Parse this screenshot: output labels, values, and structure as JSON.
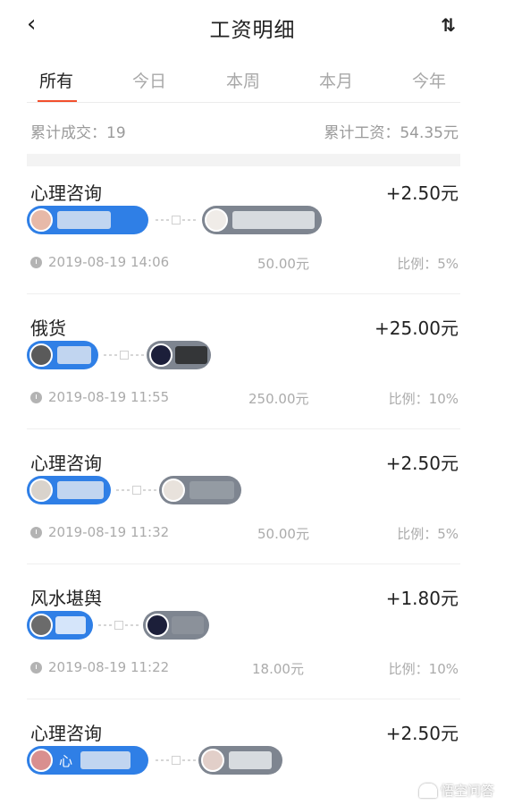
{
  "header": {
    "back_icon": "‹",
    "title": "工资明细",
    "sort_icon": "⇅"
  },
  "tabs": [
    {
      "label": "所有",
      "active": true
    },
    {
      "label": "今日",
      "active": false
    },
    {
      "label": "本周",
      "active": false
    },
    {
      "label": "本月",
      "active": false
    },
    {
      "label": "今年",
      "active": false
    }
  ],
  "accent_color": "#f2502d",
  "summary": {
    "total_deals": "累计成交：19",
    "total_wage": "累计工资：54.35元"
  },
  "records": [
    {
      "title": "心理咨询",
      "amount": "+2.50元",
      "from_text": "",
      "time": "2019-08-19 14:06",
      "price": "50.00元",
      "ratio": "比例：5%"
    },
    {
      "title": "俄货",
      "amount": "+25.00元",
      "from_text": "",
      "time": "2019-08-19 11:55",
      "price": "250.00元",
      "ratio": "比例：10%"
    },
    {
      "title": "心理咨询",
      "amount": "+2.50元",
      "from_text": "",
      "time": "2019-08-19 11:32",
      "price": "50.00元",
      "ratio": "比例：5%"
    },
    {
      "title": "风水堪舆",
      "amount": "+1.80元",
      "from_text": "",
      "time": "2019-08-19 11:22",
      "price": "18.00元",
      "ratio": "比例：10%"
    },
    {
      "title": "心理咨询",
      "amount": "+2.50元",
      "from_text": "心",
      "time": "",
      "price": "",
      "ratio": ""
    }
  ],
  "watermark": "悟空问答"
}
